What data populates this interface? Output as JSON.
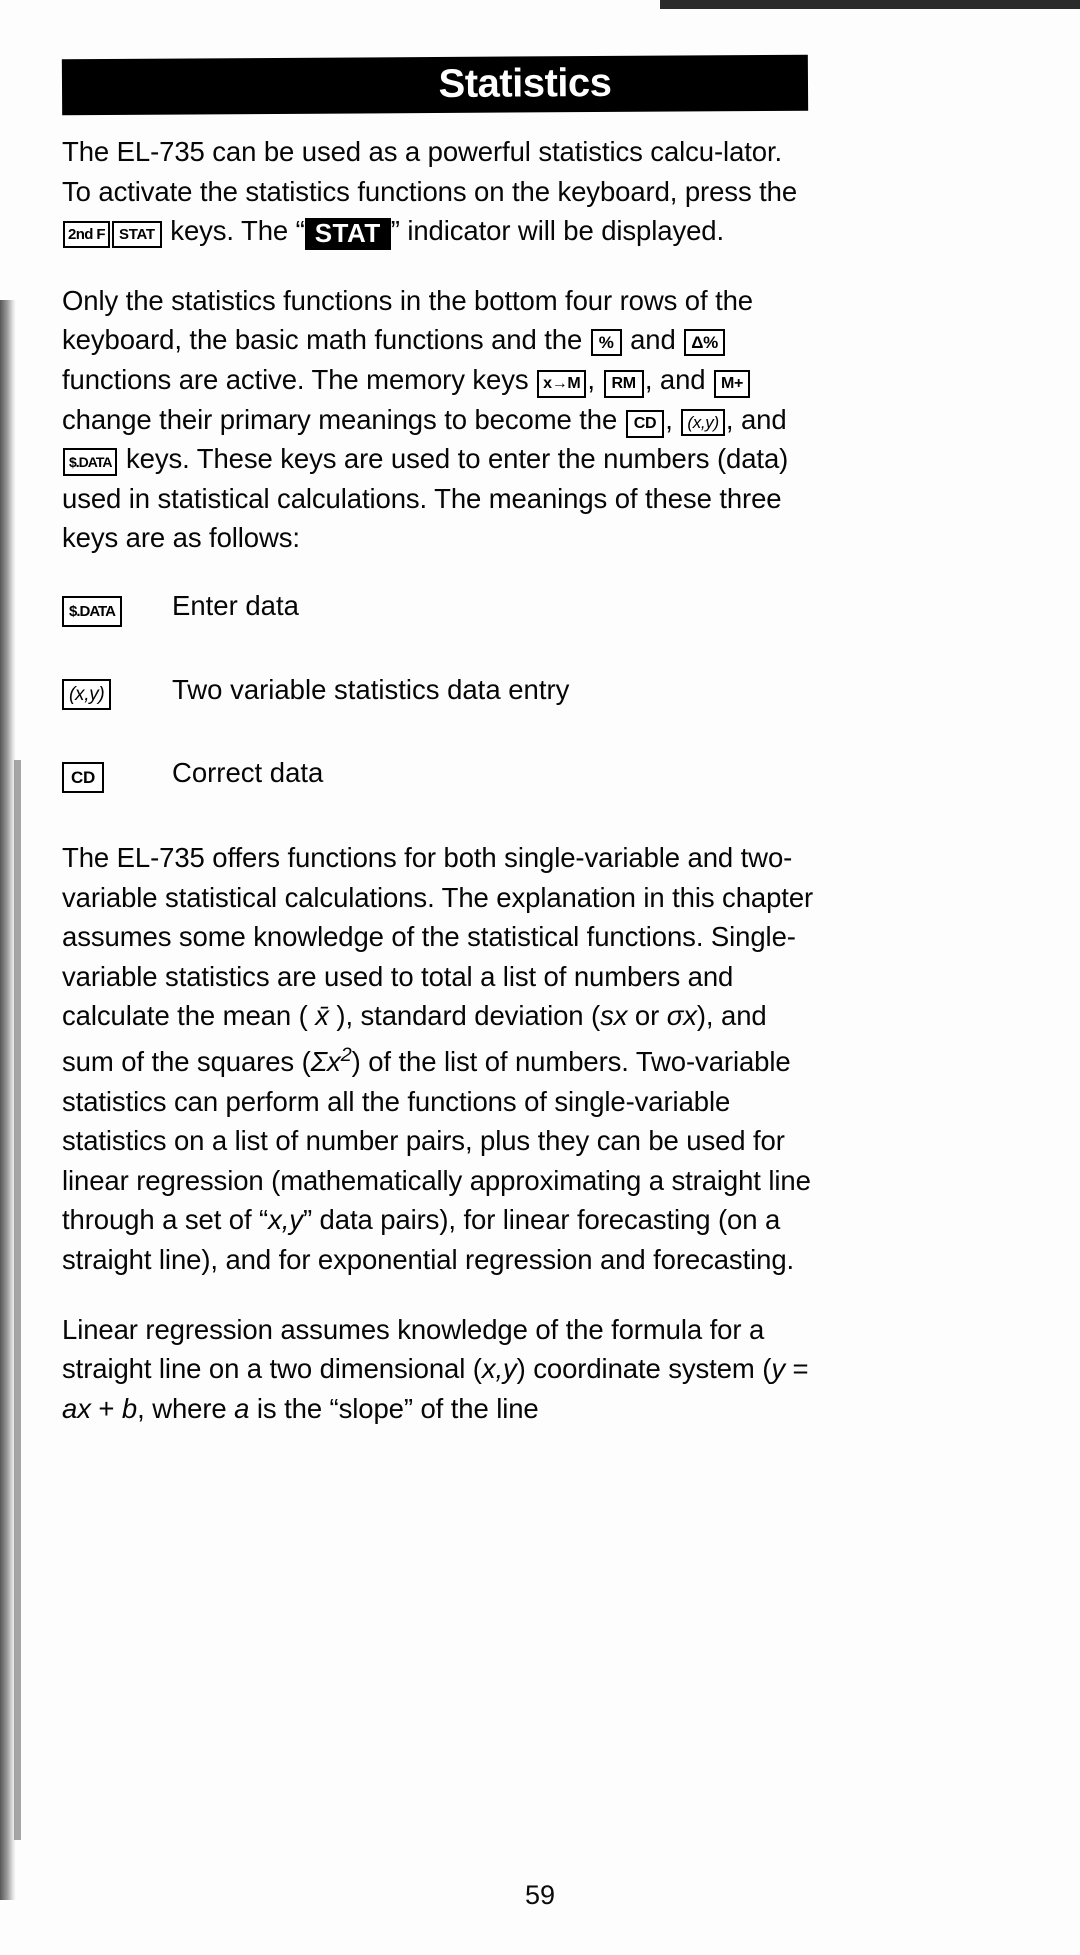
{
  "document": {
    "chapter_title": "Statistics",
    "page_number": "59"
  },
  "paragraphs": {
    "p1": {
      "seg1": "The EL-735 can be used as a powerful statistics calcu-lator. To activate the statistics functions on the keyboard, press the ",
      "key_2ndf": "2nd F",
      "key_stat": "STAT",
      "seg2": " keys. The “",
      "indicator_stat": "STAT",
      "seg3": "” indicator will be displayed."
    },
    "p2": {
      "seg1": "Only the statistics functions in the bottom four rows of the keyboard, the basic math functions and the ",
      "key_pct": "%",
      "seg2": " and ",
      "key_dpct": "Δ%",
      "seg3": " functions are active. The memory keys ",
      "key_xm": "x→M",
      "seg4": ", ",
      "key_rm": "RM",
      "seg5": ", and ",
      "key_mplus": "M+",
      "seg6": " change their primary meanings to become the ",
      "key_cd": "CD",
      "seg7": ", ",
      "key_xy": "(x,y)",
      "seg8": ", and ",
      "key_data": "$.DATA",
      "seg9": " keys. These keys are used to enter the numbers (data) used in statistical calculations. The meanings of these three keys are as follows:"
    },
    "p3": {
      "seg1": "The EL-735 offers functions for both single-variable and two-variable statistical calculations. The explanation in this chapter assumes some knowledge of the statistical functions. Single-variable statistics are used to total a list of numbers and calculate the mean ( ",
      "mean_symbol": "x̄",
      "seg2": " ), standard deviation (",
      "sx": "sx",
      "seg3": " or ",
      "sigmax": "σx",
      "seg4": "), and sum of the squares (",
      "sum_squares": "Σx",
      "sum_squares_sup": "2",
      "seg5": ") of the list of numbers. Two-variable statistics can perform all the functions of single-variable statistics on a list of number pairs, plus they can be used for linear regression (mathematically approximating a straight line through a set of “",
      "xy_italic": "x,y",
      "seg6": "” data pairs), for linear forecasting (on a straight line), and for exponential regression and forecasting."
    },
    "p4": {
      "seg1": "Linear regression assumes knowledge of the formula for a straight line on a two dimensional (",
      "xy_coord": "x,y",
      "seg2": ") coordinate system (",
      "formula_y": "y",
      "seg3": " = ",
      "formula_a": "a",
      "seg4": "x",
      "seg5": " + ",
      "formula_b": "b",
      "seg6": ", where ",
      "formula_a2": "a",
      "seg7": " is the “slope” of the line"
    }
  },
  "key_definitions": [
    {
      "key": "$.DATA",
      "key_type": "data",
      "description": "Enter data"
    },
    {
      "key": "(x,y)",
      "key_type": "xy",
      "description": "Two variable statistics data entry"
    },
    {
      "key": "CD",
      "key_type": "cd",
      "description": "Correct data"
    }
  ],
  "colors": {
    "page_background": "#ffffff",
    "text": "#060606",
    "banner_background": "#000000",
    "banner_text": "#ffffff"
  }
}
